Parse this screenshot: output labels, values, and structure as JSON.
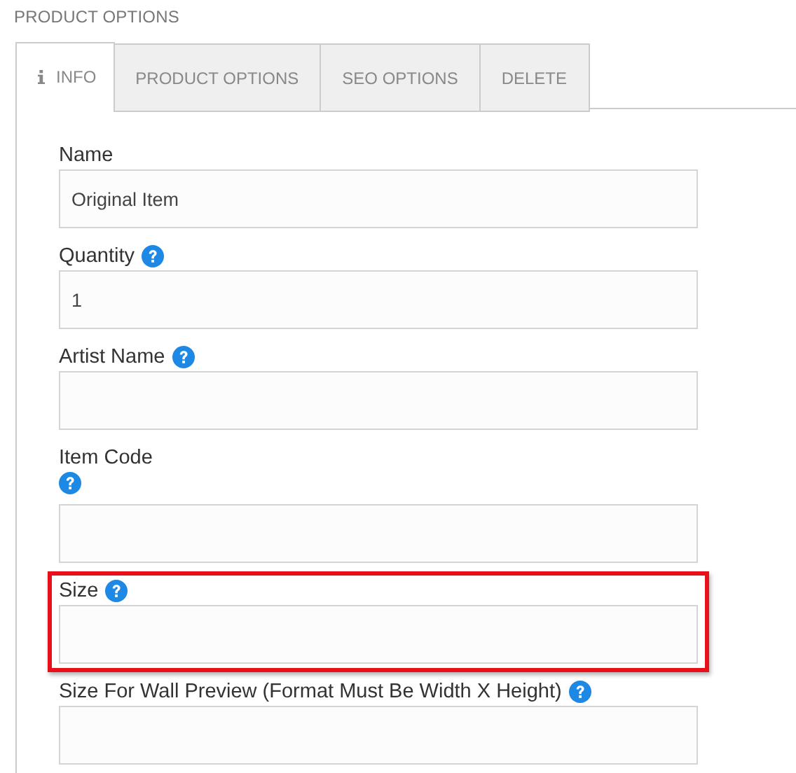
{
  "section_title": "PRODUCT OPTIONS",
  "tabs": [
    {
      "label": "INFO",
      "selected": true,
      "icon": true
    },
    {
      "label": "PRODUCT OPTIONS",
      "selected": false,
      "icon": false
    },
    {
      "label": "SEO OPTIONS",
      "selected": false,
      "icon": false
    },
    {
      "label": "DELETE",
      "selected": false,
      "icon": false
    }
  ],
  "fields": [
    {
      "kind": "plain",
      "label": "Name",
      "value": "Original Item"
    },
    {
      "kind": "help",
      "label": "Quantity",
      "value": "1"
    },
    {
      "kind": "help",
      "label": "Artist Name"
    },
    {
      "kind": "helpbelow",
      "label": "Item Code"
    },
    {
      "kind": "help",
      "label": "Size",
      "highlighted": true
    },
    {
      "kind": "help",
      "label": "Size For Wall Preview (Format Must Be Width X Height)"
    }
  ]
}
